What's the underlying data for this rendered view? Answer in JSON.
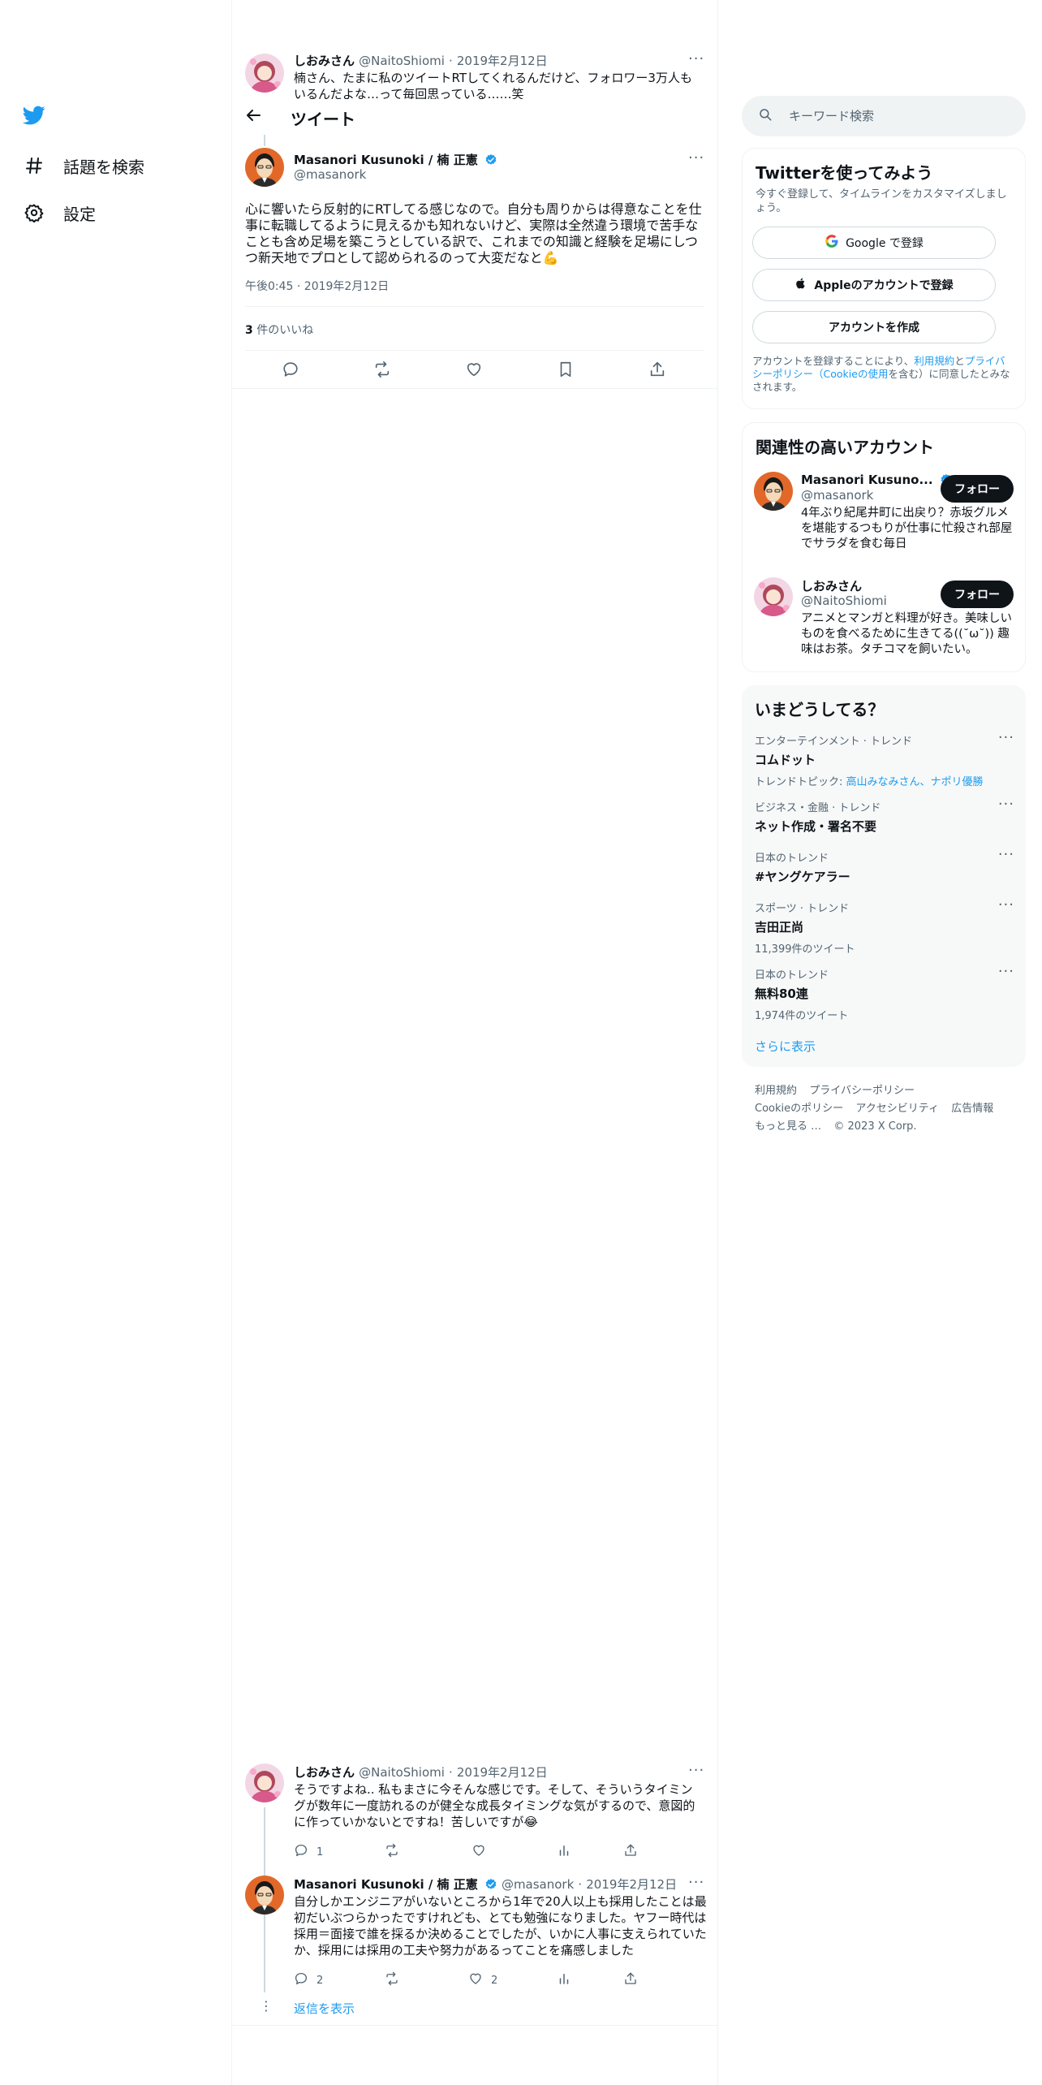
{
  "nav": {
    "items": [
      {
        "label": "話題を検索",
        "icon": "hashtag-icon"
      },
      {
        "label": "設定",
        "icon": "gear-icon"
      }
    ]
  },
  "header": {
    "title": "ツイート"
  },
  "parent_tweet": {
    "name": "しおみさん",
    "handle": "@NaitoShiomi",
    "date": "2019年2月12日",
    "text_line1": "楠さん、たまに私のツイートRTしてくれるんだけど、フォロワー3万人も",
    "text_line2": "いるんだよな…って毎回思っている……笑"
  },
  "main_tweet": {
    "name": "Masanori Kusunoki / 楠 正憲",
    "handle": "@masanork",
    "text": "心に響いたら反射的にRTしてる感じなので。自分も周りからは得意なことを仕事に転職してるように見えるかも知れないけど、実際は全然違う環境で苦手なことも含め足場を築こうとしている訳で、これまでの知識と経験を足場にしつつ新天地でプロとして認められるのって大変だなと💪",
    "timestamp": "午後0:45 · 2019年2月12日",
    "likes_count": "3",
    "likes_label": " 件のいいね"
  },
  "replies": [
    {
      "name": "しおみさん",
      "handle": "@NaitoShiomi",
      "date": "2019年2月12日",
      "text": "そうですよね.. 私もまさに今そんな感じです。そして、そういうタイミングが数年に一度訪れるのが健全な成長タイミングな気がするので、意図的に作っていかないとですね！苦しいですが😂",
      "reply_count": "1",
      "retweet_count": "",
      "like_count": ""
    },
    {
      "name": "Masanori Kusunoki / 楠 正憲",
      "handle": "@masanork",
      "date": "2019年2月12日",
      "text": "自分しかエンジニアがいないところから1年で20人以上も採用したことは最初だいぶつらかったですけれども、とても勉強になりました。ヤフー時代は採用＝面接で誰を採るか決めることでしたが、いかに人事に支えられていたか、採用には採用の工夫や努力があるってことを痛感しました",
      "reply_count": "2",
      "retweet_count": "",
      "like_count": "2"
    }
  ],
  "show_replies": "返信を表示",
  "search": {
    "placeholder": "キーワード検索"
  },
  "signup": {
    "title": "Twitterを使ってみよう",
    "subtitle": "今すぐ登録して、タイムラインをカスタマイズしましょう。",
    "google_label": "Google で登録",
    "apple_label": "Appleのアカウントで登録",
    "create_label": "アカウントを作成",
    "terms_prefix": "アカウントを登録することにより、",
    "terms_link": "利用規約",
    "terms_and": "と",
    "privacy_link": "プライバシーポリシー",
    "terms_paren_open": "（",
    "cookie_link": "Cookieの使用",
    "terms_suffix": "を含む）に同意したとみなされます。"
  },
  "related": {
    "title": "関連性の高いアカウント",
    "follow_label": "フォロー",
    "accounts": [
      {
        "name": "Masanori Kusuno...",
        "handle": "@masanork",
        "bio": "4年ぶり紀尾井町に出戻り？赤坂グルメを堪能するつもりが仕事に忙殺され部屋でサラダを食む毎日"
      },
      {
        "name": "しおみさん",
        "handle": "@NaitoShiomi",
        "bio": "アニメとマンガと料理が好き。美味しいものを食べるために生きてる((˘ω˘)) 趣味はお茶。タチコマを飼いたい。"
      }
    ]
  },
  "trends": {
    "title": "いまどうしてる？",
    "items": [
      {
        "category": "エンターテインメント · トレンド",
        "title": "コムドット",
        "sub_prefix": "トレンドトピック: ",
        "sub_link": "高山みなみさん、ナポリ優勝"
      },
      {
        "category": "ビジネス・金融 · トレンド",
        "title": "ネット作成・署名不要",
        "sub_prefix": "",
        "sub_link": ""
      },
      {
        "category": "日本のトレンド",
        "title": "#ヤングケアラー",
        "sub_prefix": "",
        "sub_link": ""
      },
      {
        "category": "スポーツ · トレンド",
        "title": "吉田正尚",
        "sub_prefix": "11,399件のツイート",
        "sub_link": ""
      },
      {
        "category": "日本のトレンド",
        "title": "無料80連",
        "sub_prefix": "1,974件のツイート",
        "sub_link": ""
      }
    ],
    "show_more": "さらに表示"
  },
  "footer": {
    "terms": "利用規約",
    "privacy": "プライバシーポリシー",
    "cookie": "Cookieのポリシー",
    "accessibility": "アクセシビリティ",
    "ads": "広告情報",
    "more": "もっと見る …",
    "copyright": "© 2023 X Corp."
  },
  "colors": {
    "accent": "#1d9bf0",
    "text": "#0f1419",
    "muted": "#536471",
    "border": "#eff3f4"
  }
}
